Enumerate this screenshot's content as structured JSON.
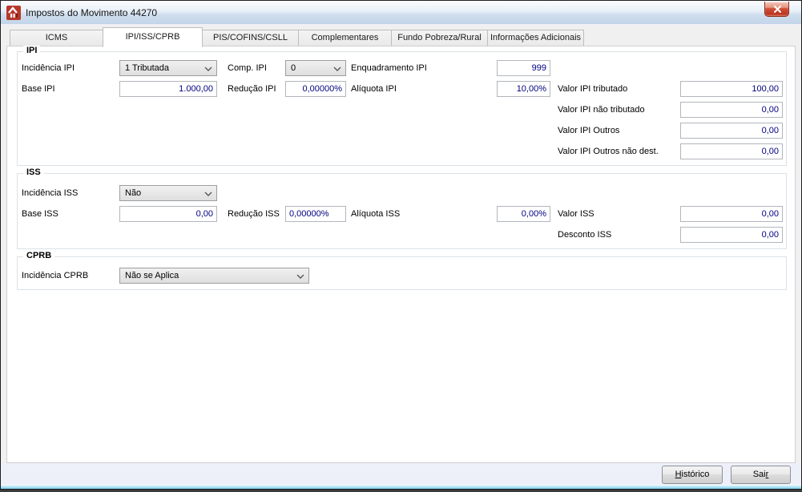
{
  "window": {
    "title": "Impostos do Movimento 44270"
  },
  "icons": {
    "app_logo": "app-logo-icon",
    "close": "close-icon",
    "chevron_down": "chevron-down-icon"
  },
  "colors": {
    "value_text": "#000080",
    "close_button_red": "#bb3420",
    "titlebar_blue": "#c3d5e9"
  },
  "tabs": [
    {
      "label": "ICMS",
      "active": false
    },
    {
      "label": "IPI/ISS/CPRB",
      "active": true
    },
    {
      "label": "PIS/COFINS/CSLL",
      "active": false
    },
    {
      "label": "Complementares",
      "active": false
    },
    {
      "label": "Fundo Pobreza/Rural",
      "active": false
    },
    {
      "label": "Informações Adicionais",
      "active": false
    }
  ],
  "sections": {
    "ipi": {
      "title": "IPI",
      "incidencia_label": "Incidência IPI",
      "incidencia_value": "1 Tributada",
      "comp_label": "Comp. IPI",
      "comp_value": "0",
      "enquadramento_label": "Enquadramento IPI",
      "enquadramento_value": "999",
      "base_label": "Base IPI",
      "base_value": "1.000,00",
      "reducao_label": "Redução IPI",
      "reducao_value": "0,00000%",
      "aliquota_label": "Alíquota IPI",
      "aliquota_value": "10,00%",
      "valor_tributado_label": "Valor IPI tributado",
      "valor_tributado_value": "100,00",
      "valor_nao_tributado_label": "Valor IPI não tributado",
      "valor_nao_tributado_value": "0,00",
      "valor_outros_label": "Valor IPI Outros",
      "valor_outros_value": "0,00",
      "valor_outros_nao_dest_label": "Valor IPI Outros não dest.",
      "valor_outros_nao_dest_value": "0,00"
    },
    "iss": {
      "title": "ISS",
      "incidencia_label": "Incidência ISS",
      "incidencia_value": "Não",
      "base_label": "Base ISS",
      "base_value": "0,00",
      "reducao_label": "Redução ISS",
      "reducao_value": "0,00000%",
      "aliquota_label": "Alíquota ISS",
      "aliquota_value": "0,00%",
      "valor_label": "Valor ISS",
      "valor_value": "0,00",
      "desconto_label": "Desconto ISS",
      "desconto_value": "0,00"
    },
    "cprb": {
      "title": "CPRB",
      "incidencia_label": "Incidência CPRB",
      "incidencia_value": "Não se Aplica"
    }
  },
  "buttons": {
    "historico": {
      "pre": "",
      "key": "H",
      "post": "istórico"
    },
    "sair": {
      "pre": "Sai",
      "key": "r",
      "post": ""
    }
  }
}
